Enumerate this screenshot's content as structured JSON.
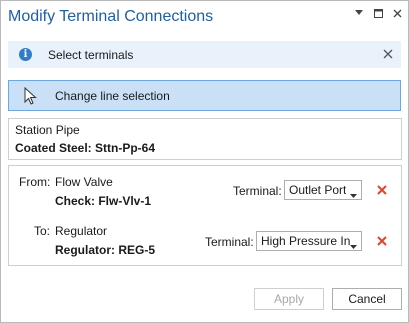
{
  "window": {
    "title": "Modify Terminal Connections"
  },
  "titlebar_buttons": {
    "dropdown_icon": "chevron-down-icon",
    "restore_icon": "restore-icon",
    "close_icon": "close-icon"
  },
  "infobar": {
    "text": "Select terminals",
    "icon": "info-icon",
    "close_icon": "close-icon"
  },
  "change_selection": {
    "label": "Change line selection",
    "icon": "cursor-arrow-icon"
  },
  "pipe": {
    "name": "Station Pipe",
    "id": "Coated Steel: Sttn-Pp-64"
  },
  "connections": [
    {
      "direction": "From:",
      "device": "Flow Valve",
      "id": "Check: Flw-Vlv-1",
      "terminal_label": "Terminal:",
      "terminal_value": "Outlet Port"
    },
    {
      "direction": "To:",
      "device": "Regulator",
      "id": "Regulator: REG-5",
      "terminal_label": "Terminal:",
      "terminal_value": "High Pressure In"
    }
  ],
  "footer": {
    "apply_label": "Apply",
    "cancel_label": "Cancel"
  },
  "colors": {
    "title": "#1f5fa6",
    "info_bg": "#e9f2fb",
    "selection_bg": "#c9e0f7",
    "selection_border": "#6da7e0",
    "delete": "#d9452b"
  }
}
